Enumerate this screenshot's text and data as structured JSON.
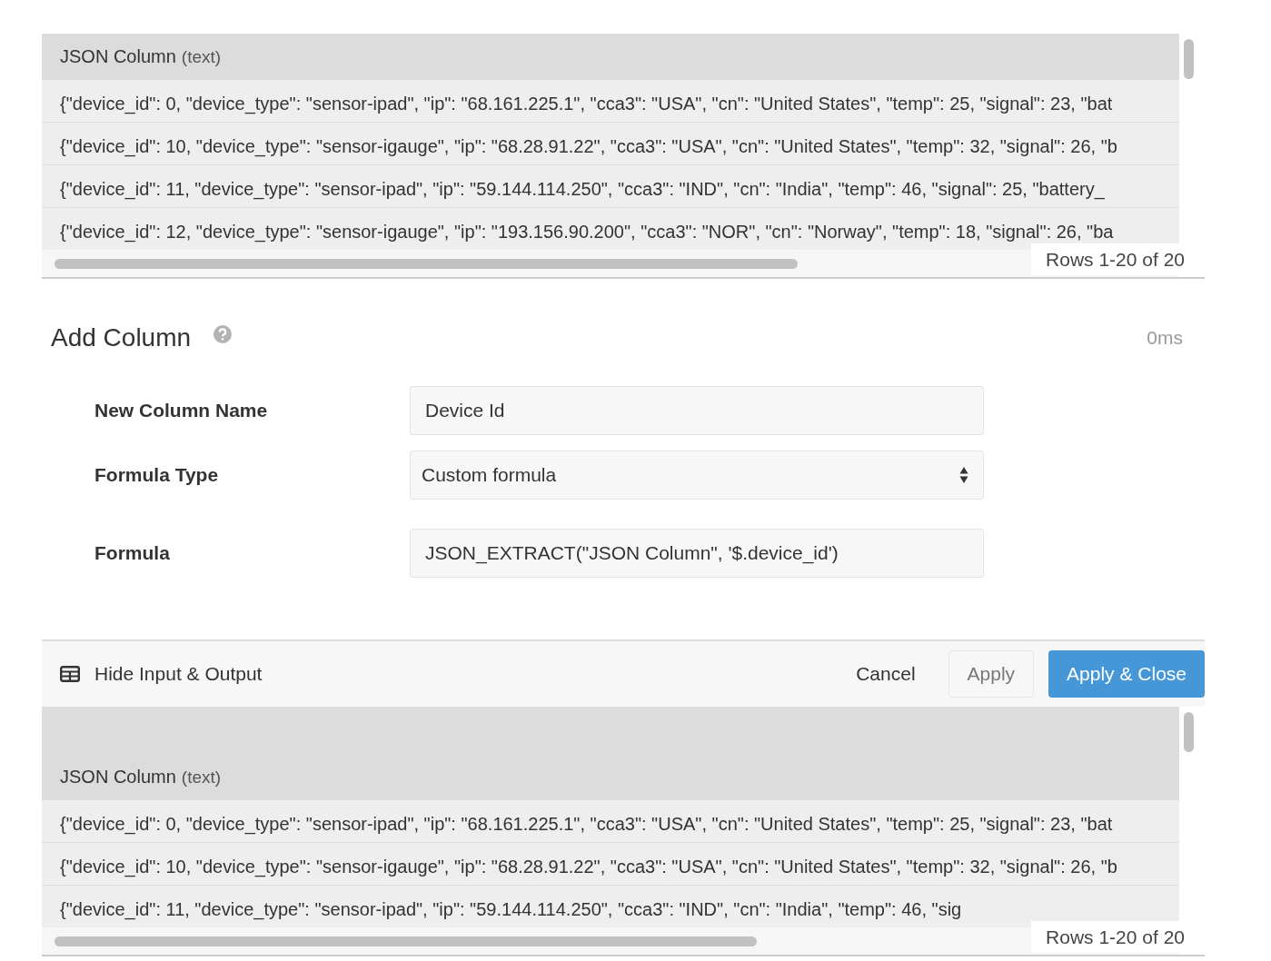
{
  "top_table": {
    "column": {
      "name": "JSON Column",
      "type": "(text)"
    },
    "rows": [
      "{\"device_id\": 0, \"device_type\": \"sensor-ipad\", \"ip\": \"68.161.225.1\", \"cca3\": \"USA\", \"cn\": \"United States\", \"temp\": 25, \"signal\": 23, \"bat",
      "{\"device_id\": 10, \"device_type\": \"sensor-igauge\", \"ip\": \"68.28.91.22\", \"cca3\": \"USA\", \"cn\": \"United States\", \"temp\": 32, \"signal\": 26, \"b",
      "{\"device_id\": 11, \"device_type\": \"sensor-ipad\", \"ip\": \"59.144.114.250\", \"cca3\": \"IND\", \"cn\": \"India\", \"temp\": 46, \"signal\": 25, \"battery_",
      "{\"device_id\": 12, \"device_type\": \"sensor-igauge\", \"ip\": \"193.156.90.200\", \"cca3\": \"NOR\", \"cn\": \"Norway\", \"temp\": 18, \"signal\": 26, \"ba"
    ],
    "row_count": "Rows 1-20 of 20"
  },
  "panel": {
    "title": "Add Column",
    "timing": "0ms",
    "fields": [
      {
        "kind": "text",
        "label": "New Column Name",
        "value": "Device Id"
      },
      {
        "kind": "select",
        "label": "Formula Type",
        "value": "Custom formula"
      },
      {
        "kind": "text",
        "label": "Formula",
        "value": "JSON_EXTRACT(\"JSON Column\", '$.device_id')"
      }
    ]
  },
  "footer": {
    "toggle": "Hide Input & Output",
    "buttons": [
      {
        "kind": "link",
        "label": "Cancel"
      },
      {
        "kind": "secondary",
        "label": "Apply"
      },
      {
        "kind": "primary",
        "label": "Apply & Close"
      }
    ]
  },
  "bottom_table": {
    "column": {
      "name": "JSON Column",
      "type": "(text)"
    },
    "rows": [
      "{\"device_id\": 0, \"device_type\": \"sensor-ipad\", \"ip\": \"68.161.225.1\", \"cca3\": \"USA\", \"cn\": \"United States\", \"temp\": 25, \"signal\": 23, \"bat",
      "{\"device_id\": 10, \"device_type\": \"sensor-igauge\", \"ip\": \"68.28.91.22\", \"cca3\": \"USA\", \"cn\": \"United States\", \"temp\": 32, \"signal\": 26, \"b",
      "{\"device_id\": 11, \"device_type\": \"sensor-ipad\", \"ip\": \"59.144.114.250\", \"cca3\": \"IND\", \"cn\": \"India\", \"temp\": 46, \"sig"
    ],
    "row_count": "Rows 1-20 of 20"
  }
}
